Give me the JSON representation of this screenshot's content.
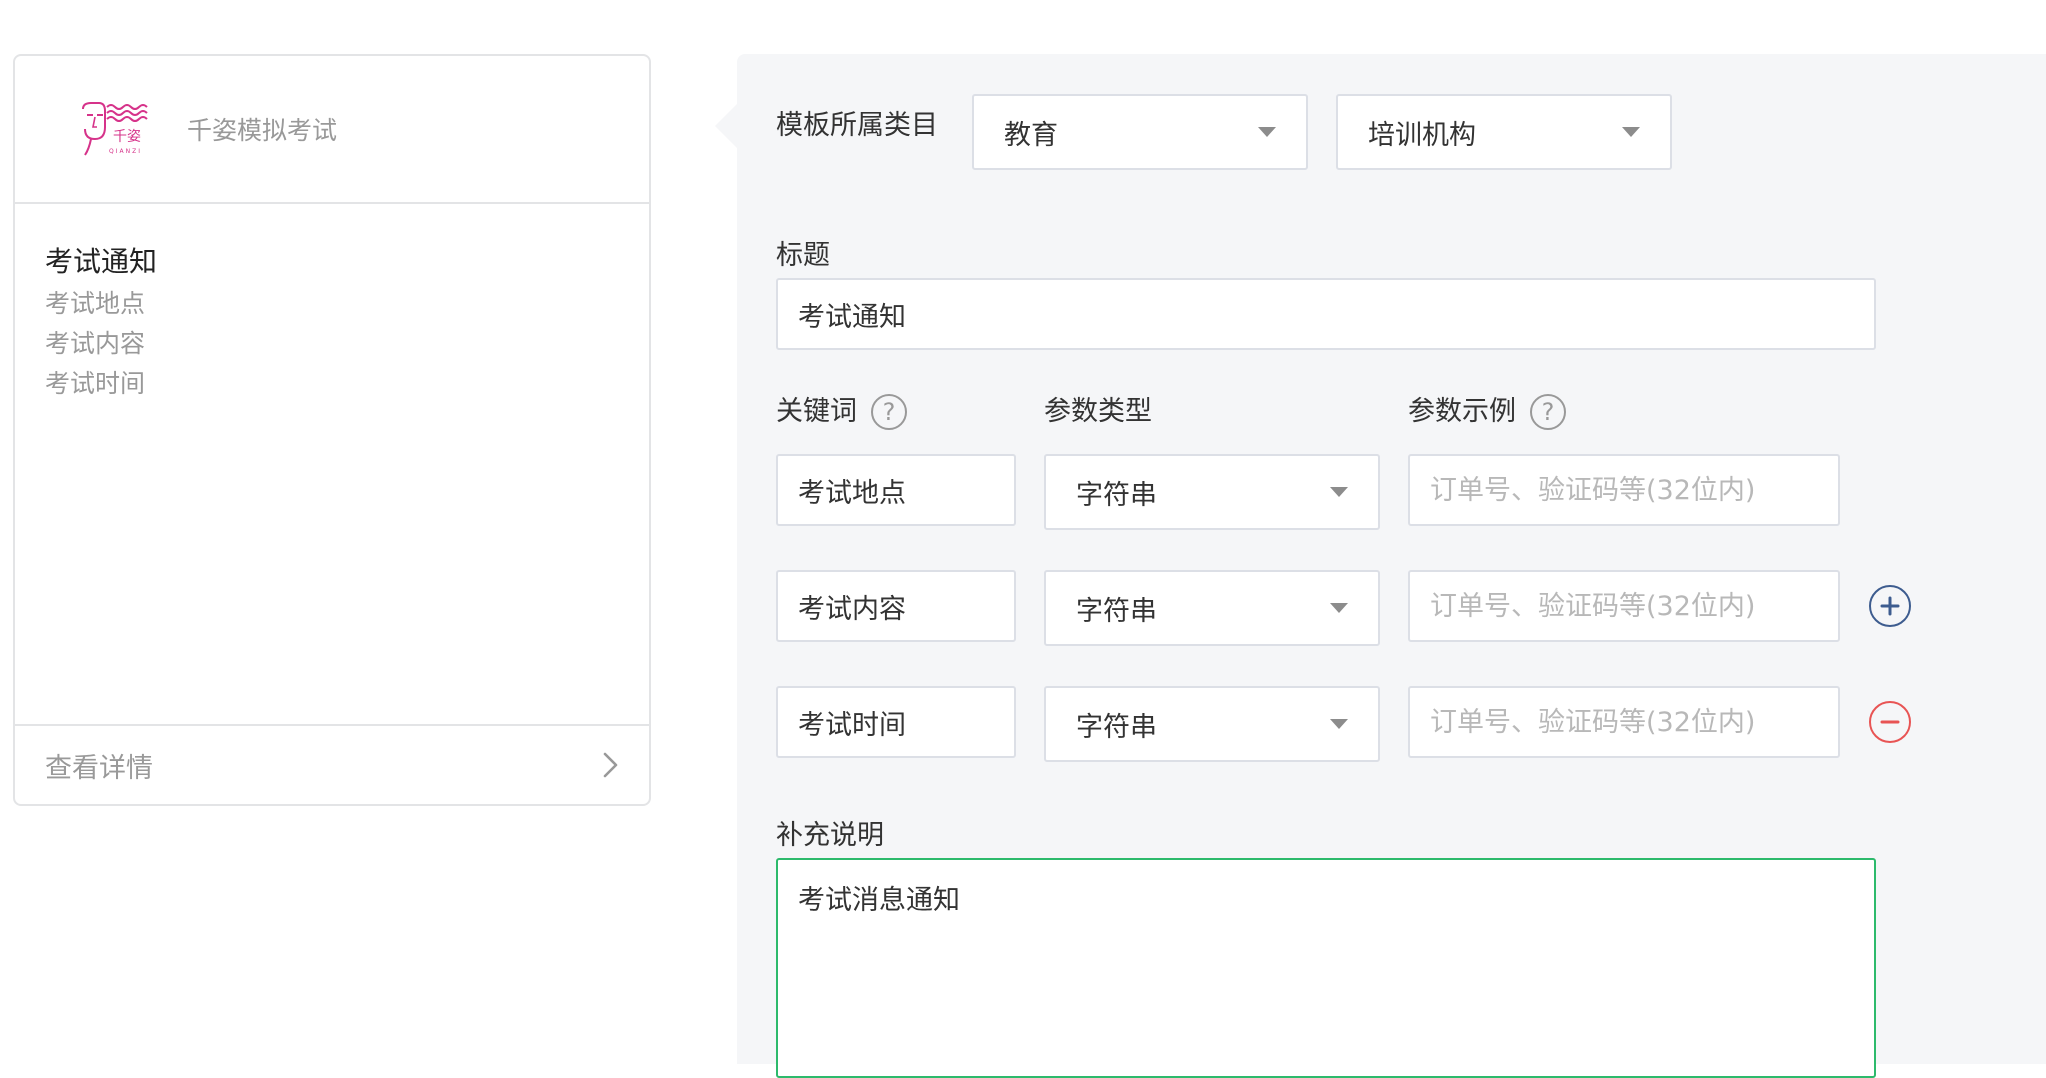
{
  "preview": {
    "brand_name": "千姿模拟考试",
    "logo_icon": "qianzi-logo-icon",
    "message_title": "考试通知",
    "message_lines": [
      "考试地点",
      "考试内容",
      "考试时间"
    ],
    "detail_label": "查看详情"
  },
  "form": {
    "category": {
      "label": "模板所属类目",
      "primary_value": "教育",
      "secondary_value": "培训机构"
    },
    "title": {
      "label": "标题",
      "value": "考试通知"
    },
    "params": {
      "headers": {
        "keyword": "关键词",
        "type": "参数类型",
        "example": "参数示例"
      },
      "help_icon_glyph": "?",
      "rows": [
        {
          "keyword": "考试地点",
          "type": "字符串",
          "example_placeholder": "订单号、验证码等(32位内)"
        },
        {
          "keyword": "考试内容",
          "type": "字符串",
          "example_placeholder": "订单号、验证码等(32位内)"
        },
        {
          "keyword": "考试时间",
          "type": "字符串",
          "example_placeholder": "订单号、验证码等(32位内)"
        }
      ]
    },
    "description": {
      "label": "补充说明",
      "value": "考试消息通知"
    }
  },
  "colors": {
    "panel_bg": "#f5f6f8",
    "border": "#dcdfe6",
    "focus_border": "#2dba6c",
    "add_button": "#3d5c8f",
    "remove_button": "#e85454",
    "brand_pink": "#d6338a"
  }
}
